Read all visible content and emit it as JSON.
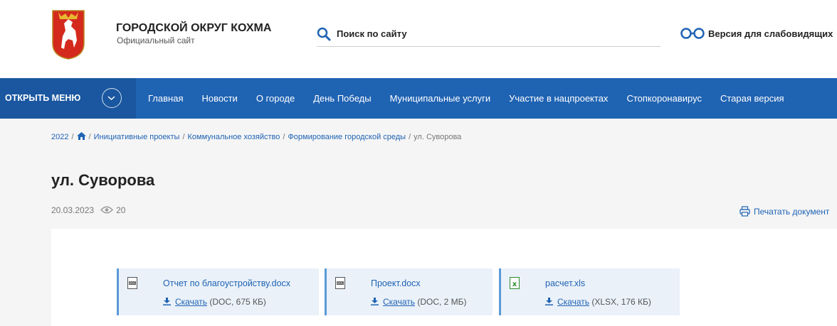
{
  "header": {
    "site_title": "ГОРОДСКОЙ ОКРУГ КОХМА",
    "site_subtitle": "Официальный сайт",
    "search_placeholder": "Поиск по сайту",
    "accessibility_label": "Версия для слабовидящих"
  },
  "nav": {
    "menu_label": "ОТКРЫТЬ МЕНЮ",
    "items": [
      "Главная",
      "Новости",
      "О городе",
      "День Победы",
      "Муниципальные услуги",
      "Участие в нацпроектах",
      "Стопкоронавирус",
      "Старая версия"
    ]
  },
  "breadcrumb": {
    "year": "2022",
    "items": [
      "Инициативные проекты",
      "Коммунальное хозяйство",
      "Формирование городской среды"
    ],
    "current": "ул. Суворова"
  },
  "page": {
    "title": "ул. Суворова",
    "date": "20.03.2023",
    "views": "20",
    "print_label": "Печатать документ"
  },
  "files": [
    {
      "name": "Отчет по благоустройству.docx",
      "download_label": "Скачать",
      "info": "(DOC, 675 КБ)",
      "type_icon": "doc-icon"
    },
    {
      "name": "Проект.docx",
      "download_label": "Скачать",
      "info": "(DOC, 2 МБ)",
      "type_icon": "doc-icon"
    },
    {
      "name": "расчет.xls",
      "download_label": "Скачать",
      "info": "(XLSX, 176 КБ)",
      "type_icon": "xls-icon"
    }
  ],
  "colors": {
    "nav_bg": "#1f63b3",
    "link": "#1f63b3",
    "file_bg": "#eaf1f9",
    "file_border": "#5a9ad6",
    "xls_green": "#2e8b2e"
  }
}
